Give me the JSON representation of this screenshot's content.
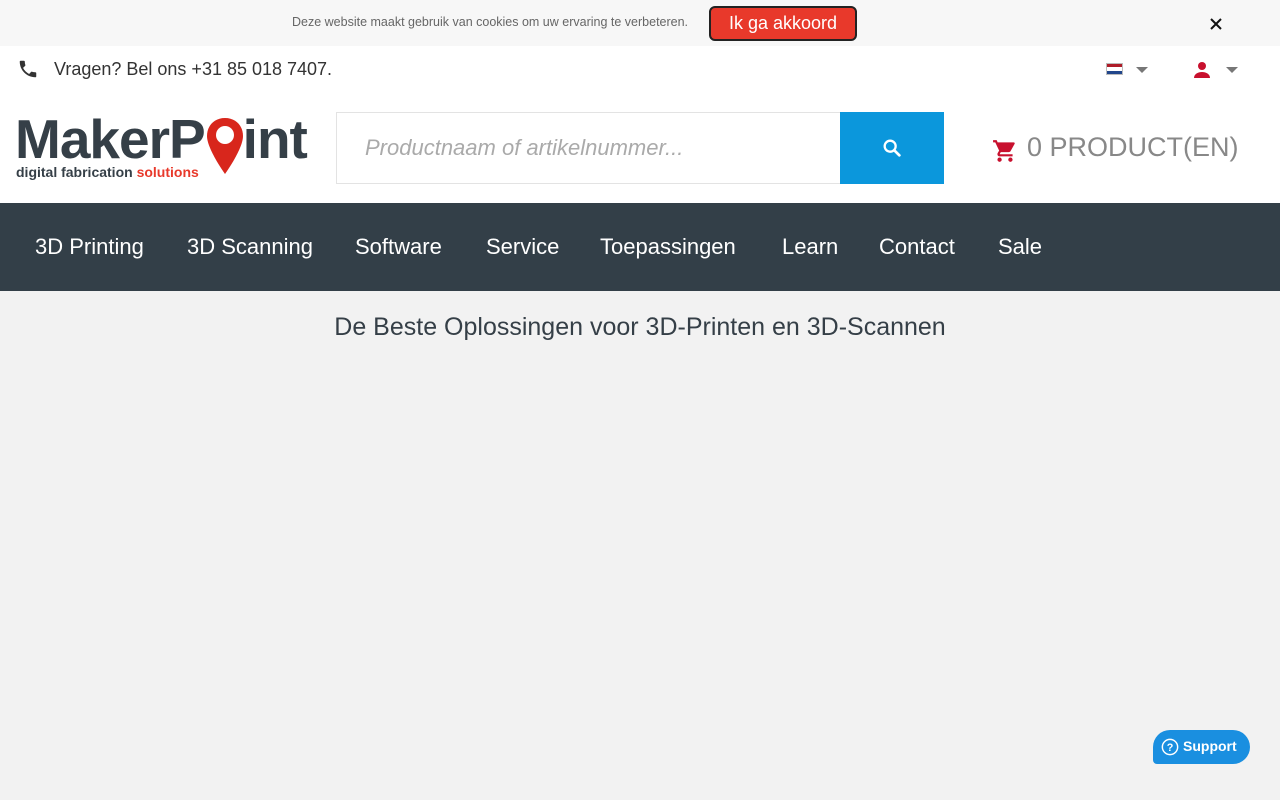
{
  "cookie": {
    "message": "Deze website maakt gebruik van cookies om uw ervaring te verbeteren.",
    "accept_label": "Ik ga akkoord"
  },
  "topbar": {
    "phone_text": "Vragen? Bel ons +31 85 018 7407."
  },
  "logo": {
    "main_part1": "MakerP",
    "main_part2": "int",
    "tagline_part1": "digital fabrication ",
    "tagline_part2": "solutions"
  },
  "search": {
    "placeholder": "Productnaam of artikelnummer...",
    "value": ""
  },
  "cart": {
    "label": "0 PRODUCT(EN)"
  },
  "nav": {
    "items": [
      {
        "label": "3D Printing"
      },
      {
        "label": "3D Scanning"
      },
      {
        "label": "Software"
      },
      {
        "label": "Service"
      },
      {
        "label": "Toepassingen"
      },
      {
        "label": "Learn"
      },
      {
        "label": "Contact"
      },
      {
        "label": "Sale"
      }
    ]
  },
  "main": {
    "title": "De Beste Oplossingen voor 3D-Printen en 3D-Scannen"
  },
  "support": {
    "label": "Support"
  },
  "icons": {
    "phone": "phone-icon",
    "search": "search-icon",
    "cart": "cart-icon",
    "user": "user-icon",
    "close": "close-icon",
    "flag": "netherlands-flag-icon",
    "support": "question-circle-icon"
  },
  "colors": {
    "brand_red": "#e8392b",
    "brand_dark": "#333f48",
    "search_blue": "#0b97dc",
    "cart_red": "#c8102e",
    "support_blue": "#1a8fe0"
  }
}
